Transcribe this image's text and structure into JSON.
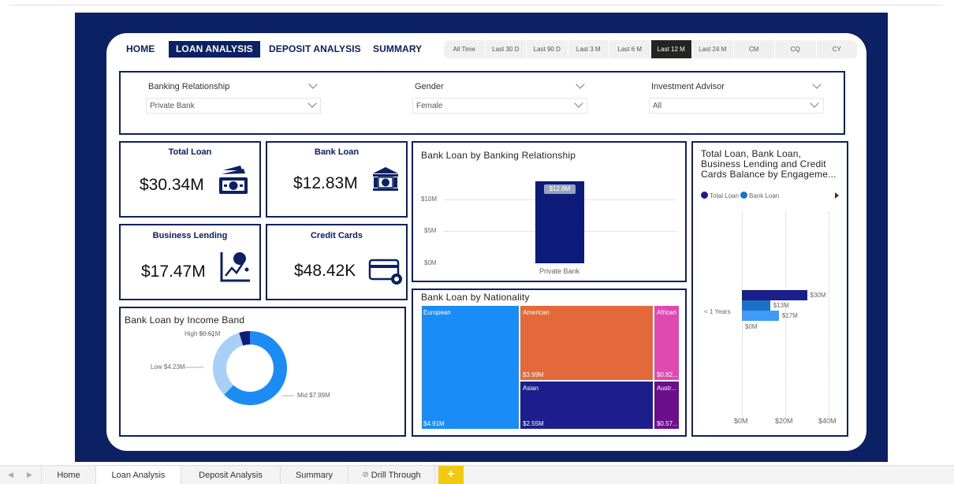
{
  "nav": {
    "home": "HOME",
    "loan": "LOAN ANALYSIS",
    "deposit": "DEPOSIT ANALYSIS",
    "summary": "SUMMARY"
  },
  "date_filter": [
    "All Time",
    "Last 30 D",
    "Last 90 D",
    "Last 3 M",
    "Last 6 M",
    "Last 12 M",
    "Last 24 M",
    "CM",
    "CQ",
    "CY"
  ],
  "date_filter_selected": "Last 12 M",
  "slicers": {
    "banking": {
      "label": "Banking Relationship",
      "value": "Private Bank"
    },
    "gender": {
      "label": "Gender",
      "value": "Female"
    },
    "advisor": {
      "label": "Investment Advisor",
      "value": "All"
    }
  },
  "kpis": {
    "total_loan": {
      "title": "Total Loan",
      "value": "$30.34M",
      "icon": "money-stack-icon"
    },
    "bank_loan": {
      "title": "Bank Loan",
      "value": "$12.83M",
      "icon": "bank-building-icon"
    },
    "business_lending": {
      "title": "Business Lending",
      "value": "$17.47M",
      "icon": "growth-chart-icon"
    },
    "credit_cards": {
      "title": "Credit Cards",
      "value": "$48.42K",
      "icon": "credit-card-gear-icon"
    }
  },
  "chart_data": [
    {
      "type": "bar",
      "title": "Bank Loan by Banking Relationship",
      "categories": [
        "Private Bank"
      ],
      "values": [
        12.8
      ],
      "data_labels": [
        "$12.8M"
      ],
      "y_ticks": [
        "$10M",
        "$5M",
        "$0M"
      ],
      "ylim": [
        0,
        13
      ],
      "color": "#0d1b7a"
    },
    {
      "type": "pie",
      "title": "Bank Loan by Income Band",
      "categories": [
        "Mid",
        "Low",
        "High"
      ],
      "values": [
        7.99,
        4.23,
        0.61
      ],
      "labels": [
        "Mid $7.99M",
        "Low $4.23M",
        "High $0.61M"
      ],
      "colors": [
        "#1c8cf5",
        "#a8d0f7",
        "#0d1b7a"
      ]
    },
    {
      "type": "heatmap",
      "title": "Bank Loan by Nationality",
      "categories": [
        "European",
        "American",
        "Asian",
        "African",
        "Australian"
      ],
      "labels": [
        "European",
        "American",
        "Asian",
        "African",
        "Austr..."
      ],
      "values": [
        4.91,
        3.99,
        2.55,
        0.82,
        0.57
      ],
      "value_labels": [
        "$4.91M",
        "$3.99M",
        "$2.55M",
        "$0.82...",
        "$0.57..."
      ],
      "colors": [
        "#1a8cf7",
        "#e3683a",
        "#1b1e8c",
        "#e048b2",
        "#6b0f8c"
      ]
    },
    {
      "type": "bar",
      "orientation": "horizontal",
      "title": "Total Loan, Bank Loan, Business Lending and Credit Cards Balance by Engageme...",
      "categories": [
        "< 1 Years"
      ],
      "legend": [
        "Total Loan",
        "Bank Loan"
      ],
      "series": [
        {
          "name": "Total Loan",
          "values": [
            30
          ],
          "label": "$30M",
          "color": "#1a1f8c"
        },
        {
          "name": "Bank Loan",
          "values": [
            13
          ],
          "label": "$13M",
          "color": "#1a72c8"
        },
        {
          "values": [
            17
          ],
          "label": "$17M",
          "color": "#3f9bf5"
        },
        {
          "values": [
            0
          ],
          "label": "$0M",
          "color": "#e048b2"
        }
      ],
      "x_ticks": [
        "$0M",
        "$20M",
        "$40M"
      ],
      "xlim": [
        0,
        45
      ]
    }
  ],
  "tabs": [
    "Home",
    "Loan Analysis",
    "Deposit Analysis",
    "Summary",
    "Drill Through"
  ],
  "active_tab": "Loan Analysis",
  "add_page": "+"
}
